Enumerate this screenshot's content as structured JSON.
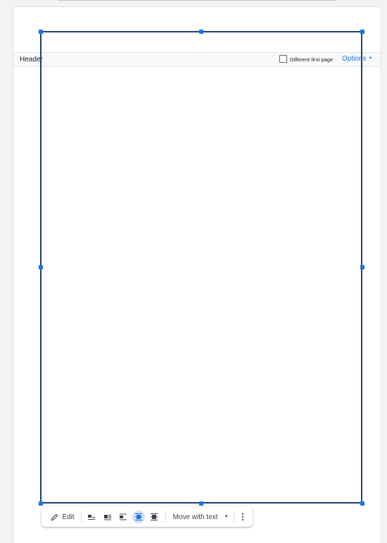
{
  "header": {
    "label": "Header",
    "different_first_page_label": "Different first page",
    "different_first_page_checked": false,
    "options_label": "Options"
  },
  "toolbar": {
    "edit_label": "Edit",
    "wrap_options": [
      {
        "name": "inline",
        "active": false
      },
      {
        "name": "wrap-text",
        "active": false
      },
      {
        "name": "break-text",
        "active": false
      },
      {
        "name": "behind-text",
        "active": true
      },
      {
        "name": "in-front-of-text",
        "active": false
      }
    ],
    "position_label": "Move with text",
    "more_icon": "more-vert-icon"
  },
  "colors": {
    "accent": "#1a73e8",
    "frame": "#1f3f77",
    "active_bg": "#d3e3fd"
  }
}
